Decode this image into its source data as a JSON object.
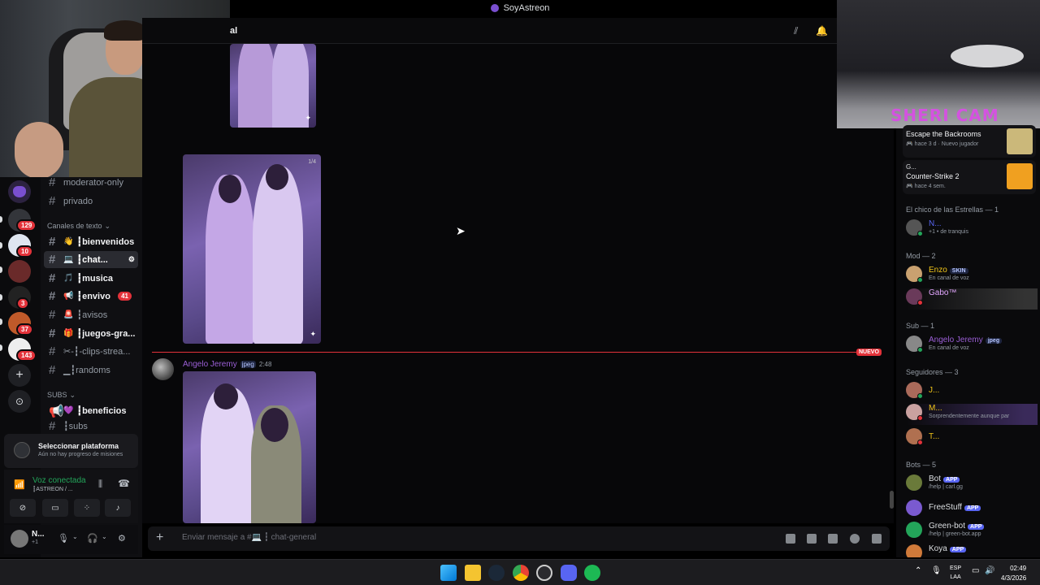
{
  "window": {
    "title": "SoyAstreon"
  },
  "header": {
    "channel_title_fragment": "al"
  },
  "guild_badges": [
    "129",
    "10",
    "3",
    "37",
    "143"
  ],
  "channels": {
    "category_text": "Canales de texto",
    "category_subs": "SUBS",
    "items": [
      {
        "label": "moderator-only",
        "emoji": ""
      },
      {
        "label": "privado",
        "emoji": ""
      },
      {
        "label": "┇bienvenidos",
        "emoji": "👋"
      },
      {
        "label": "┇chat...",
        "emoji": "💻"
      },
      {
        "label": "┇musica",
        "emoji": "🎵"
      },
      {
        "label": "┇envivo",
        "emoji": "📢",
        "count": "41"
      },
      {
        "label": "┇avisos",
        "emoji": "🚨"
      },
      {
        "label": "┇juegos-gra...",
        "emoji": "🎁"
      },
      {
        "label": "✂-┇-clips-strea...",
        "emoji": ""
      },
      {
        "label": "▁┇randoms",
        "emoji": ""
      },
      {
        "label": "┇beneficios",
        "emoji": "💜"
      },
      {
        "label": "┇subs",
        "emoji": ""
      }
    ]
  },
  "message": {
    "author": "Angelo Jeremy",
    "tag": "jpeg",
    "time": "2:48",
    "new_label": "NUEVO",
    "image_counter": "1/4"
  },
  "composer": {
    "placeholder": "Enviar mensaje a #💻 ┇ chat-general"
  },
  "quests": {
    "title": "Seleccionar plataforma",
    "subtitle": "Aún no hay progreso de misiones"
  },
  "voice": {
    "status": "Voz conectada",
    "channel": "┇ASTREON / ..."
  },
  "user": {
    "name": "N...",
    "status": "+1"
  },
  "stream": {
    "label": "SHERI CAM"
  },
  "members": {
    "activities": [
      {
        "title": "Escape the Backrooms",
        "sub1": "hace 3 d",
        "sub2": "Nuevo jugador"
      },
      {
        "name": "G...",
        "title": "Counter-Strike 2",
        "sub1": "hace 4 sem."
      }
    ],
    "groups": [
      {
        "header": "El chico de las Estrellas — 1",
        "members": [
          {
            "name": "N...",
            "status": "+1 • de tranquis",
            "color": "#5865f2"
          }
        ]
      },
      {
        "header": "Mod — 2",
        "members": [
          {
            "name": "Enzo",
            "tag": "SKIN",
            "status": "En canal de voz",
            "color": "#f0c419"
          },
          {
            "name": "Gabo™",
            "status": "",
            "color": "#e3a7ff"
          }
        ]
      },
      {
        "header": "Sub — 1",
        "members": [
          {
            "name": "Angelo Jeremy",
            "tag": "jpeg",
            "status": "En canal de voz",
            "color": "#9b5fd6"
          }
        ]
      },
      {
        "header": "Seguidores — 3",
        "members": [
          {
            "name": "J...",
            "status": "",
            "color": "#f0c419"
          },
          {
            "name": "M...",
            "status": "Sorprendentemente aunque par",
            "color": "#f0c419"
          },
          {
            "name": "T...",
            "status": "",
            "color": "#f0c419"
          }
        ]
      },
      {
        "header": "Bots — 5",
        "members": [
          {
            "name": "Bot",
            "tag": "APP",
            "status": "/help | carl.gg",
            "color": "#dbdee1"
          },
          {
            "name": "FreeStuff",
            "tag": "APP",
            "status": "",
            "color": "#dbdee1"
          },
          {
            "name": "Green-bot",
            "tag": "APP",
            "status": "/help | green-bot.app",
            "color": "#dbdee1"
          },
          {
            "name": "Koya",
            "tag": "APP",
            "status": "",
            "color": "#dbdee1"
          }
        ]
      }
    ]
  },
  "taskbar": {
    "lang1": "ESP",
    "lang2": "LAA",
    "time": "02:49",
    "date": "4/3/2026"
  },
  "colors": {
    "accent": "#5865f2",
    "danger": "#e3323a",
    "online": "#23a55a",
    "author": "#9b5fd6"
  }
}
